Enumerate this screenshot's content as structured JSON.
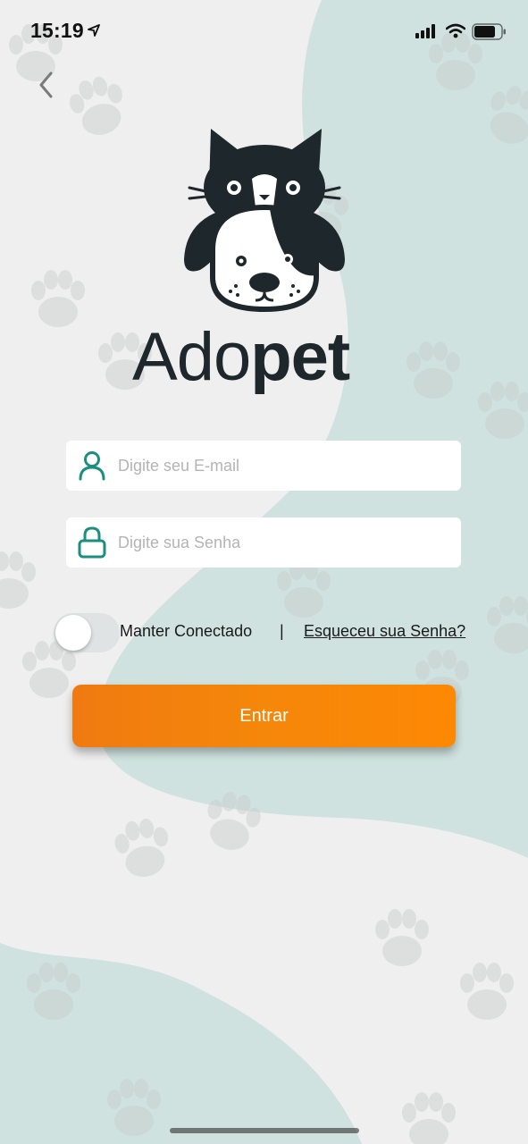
{
  "status_bar": {
    "time": "15:19",
    "icons": [
      "location-arrow-icon",
      "cellular-signal-icon",
      "wifi-icon",
      "battery-icon"
    ]
  },
  "navigation": {
    "back_icon": "chevron-left-icon"
  },
  "logo": {
    "text_light": "Ado",
    "text_bold": "pet",
    "icon": "cat-and-dog-logo"
  },
  "form": {
    "email": {
      "placeholder": "Digite seu E-mail",
      "value": "",
      "icon": "user-icon"
    },
    "password": {
      "placeholder": "Digite sua Senha",
      "value": "",
      "icon": "lock-icon"
    },
    "keep_connected": {
      "label": "Manter Conectado",
      "checked": false
    },
    "separator": "|",
    "forgot_password": "Esqueceu sua Senha?",
    "submit_label": "Entrar"
  },
  "colors": {
    "accent_teal": "#1a8f7e",
    "button_orange": "#f5870a",
    "background": "#efefef",
    "background_shape": "#cfe2df",
    "logo_dark": "#1e272b"
  }
}
